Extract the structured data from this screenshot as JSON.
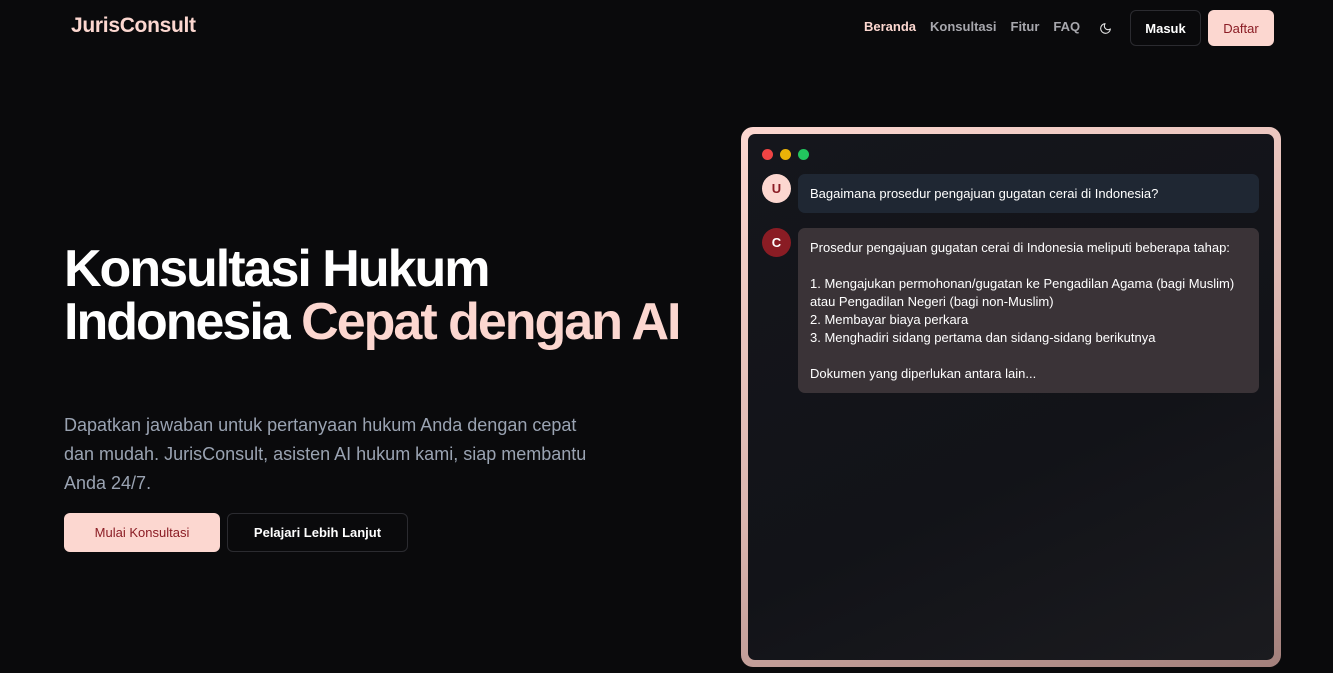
{
  "nav": {
    "logo": "JurisConsult",
    "links": [
      {
        "label": "Beranda",
        "active": true
      },
      {
        "label": "Konsultasi",
        "active": false
      },
      {
        "label": "Fitur",
        "active": false
      },
      {
        "label": "FAQ",
        "active": false
      }
    ],
    "theme_icon": "moon-icon",
    "login_label": "Masuk",
    "register_label": "Daftar"
  },
  "hero": {
    "title_part1": "Konsultasi Hukum Indonesia",
    "title_accent": "Cepat dengan AI",
    "subtitle": "Dapatkan jawaban untuk pertanyaan hukum Anda dengan cepat dan mudah. JurisConsult, asisten AI hukum kami, siap membantu Anda 24/7.",
    "primary_button": "Mulai Konsultasi",
    "secondary_button": "Pelajari Lebih Lanjut"
  },
  "chat": {
    "user_avatar": "U",
    "bot_avatar": "C",
    "user_message": "Bagaimana prosedur pengajuan gugatan cerai di Indonesia?",
    "bot_message": "Prosedur pengajuan gugatan cerai di Indonesia meliputi beberapa tahap:\n\n1. Mengajukan permohonan/gugatan ke Pengadilan Agama (bagi Muslim) atau Pengadilan Negeri (bagi non-Muslim)\n2. Membayar biaya perkara\n3. Menghadiri sidang pertama dan sidang-sidang berikutnya\n\nDokumen yang diperlukan antara lain..."
  },
  "colors": {
    "background": "#0a0a0c",
    "accent": "#fcd7d0",
    "accent_dark": "#8a1c24",
    "muted_text": "#9aa3b2"
  }
}
